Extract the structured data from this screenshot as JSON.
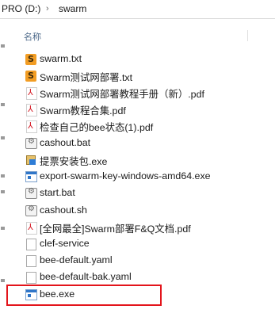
{
  "address_bar": {
    "drive": "PRO (D:)",
    "separator": "›",
    "folder": "swarm"
  },
  "list_header": {
    "name_column": "名称"
  },
  "files": [
    {
      "name": "swarm.txt",
      "icon": "sublime-text-icon"
    },
    {
      "name": "Swarm测试网部署.txt",
      "icon": "sublime-text-icon"
    },
    {
      "name": "Swarm测试网部署教程手册（新）.pdf",
      "icon": "pdf-icon"
    },
    {
      "name": "Swarm教程合集.pdf",
      "icon": "pdf-icon"
    },
    {
      "name": "检查自己的bee状态(1).pdf",
      "icon": "pdf-icon"
    },
    {
      "name": "cashout.bat",
      "icon": "batch-file-icon"
    },
    {
      "name": "提票安装包.exe",
      "icon": "installer-icon"
    },
    {
      "name": "export-swarm-key-windows-amd64.exe",
      "icon": "application-icon"
    },
    {
      "name": "start.bat",
      "icon": "batch-file-icon"
    },
    {
      "name": "cashout.sh",
      "icon": "batch-file-icon"
    },
    {
      "name": "[全网最全]Swarm部署F&Q文档.pdf",
      "icon": "pdf-icon"
    },
    {
      "name": "clef-service",
      "icon": "blank-file-icon"
    },
    {
      "name": "bee-default.yaml",
      "icon": "blank-file-icon"
    },
    {
      "name": "bee-default-bak.yaml",
      "icon": "blank-file-icon"
    },
    {
      "name": "bee.exe",
      "icon": "application-icon"
    }
  ],
  "highlighted_file": "bee.exe",
  "colors": {
    "highlight_border": "#e3141b",
    "header_text": "#4e6a8a"
  }
}
